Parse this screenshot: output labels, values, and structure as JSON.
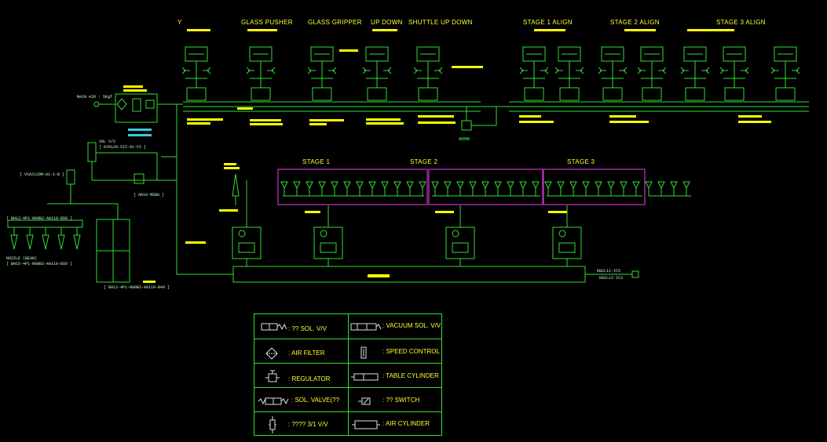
{
  "colors": {
    "background": "#000000",
    "line": "#33dd33",
    "text": "#ffff33",
    "highlight": "#ffff00",
    "cyan": "#33ccdd",
    "frame": "#cc33cc",
    "white": "#e0e0e0"
  },
  "section_titles": {
    "y": "Y",
    "glass_pusher": "GLASS PUSHER",
    "glass_gripper": "GLASS GRIPPER",
    "up_down": "UP DOWN",
    "shuttle_up_down": "SHUTTLE UP DOWN",
    "stage1_align": "STAGE 1 ALIGN",
    "stage2_align": "STAGE 2  ALIGN",
    "stage3_align": "STAGE 3 ALIGN"
  },
  "stage_labels": {
    "stage1": "STAGE 1",
    "stage2": "STAGE 2",
    "stage3": "STAGE 3"
  },
  "annotations": {
    "main_air": "MAIN AIR : 5Kgf",
    "sol_vv": "SOL V/V",
    "sol_code": "[ EV9120-5IZ-01-F2 ]",
    "vacuum_code": "[ VXA2120M-01-1-B ]",
    "regulator_code": "[ AR10-M5BG ]",
    "block_code": "[ BH12-4P1-N08B2-A0110-B50 ]",
    "nozzle": "NOZZLE (BEAN)",
    "nozzle_code": "[ BH15-4P1-N08B2-A0110-B50 ]",
    "tank_code": "[ BH12-4P1-N08B2-A0110-B49 ]",
    "out1": "KB2L12-IC5",
    "out2": "KB2L12-IC3"
  },
  "legend": {
    "items": [
      {
        "label": ": ?? SOL. V/V",
        "icon": "sol-valve-icon"
      },
      {
        "label": ": VACUUM SOL. V/V",
        "icon": "vacuum-sol-valve-icon"
      },
      {
        "label": ": AIR FILTER",
        "icon": "air-filter-icon"
      },
      {
        "label": ": SPEED CONTROL",
        "icon": "speed-control-icon"
      },
      {
        "label": ": REGULATOR",
        "icon": "regulator-icon"
      },
      {
        "label": ": TABLE CYLINDER",
        "icon": "table-cylinder-icon"
      },
      {
        "label": ": SOL. VALVE(??",
        "icon": "sol-valve-2-icon"
      },
      {
        "label": ": ?? SWITCH",
        "icon": "switch-icon"
      },
      {
        "label": ": ???? 3/1 V/V",
        "icon": "three-way-valve-icon"
      },
      {
        "label": ": AIR CYLINDER",
        "icon": "air-cylinder-icon"
      }
    ]
  }
}
